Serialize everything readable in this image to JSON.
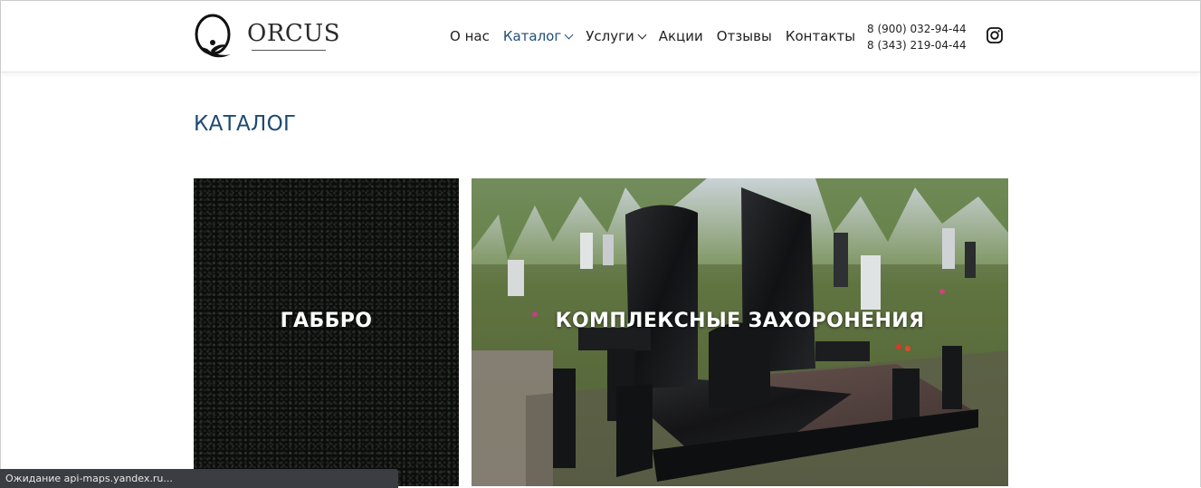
{
  "brand": {
    "name": "ORCUS"
  },
  "nav": {
    "items": [
      {
        "label": "О нас"
      },
      {
        "label": "Каталог"
      },
      {
        "label": "Услуги"
      },
      {
        "label": "Акции"
      },
      {
        "label": "Отзывы"
      },
      {
        "label": "Контакты"
      }
    ]
  },
  "contacts": {
    "phone1": "8 (900) 032-94-44",
    "phone2": "8 (343) 219-04-44"
  },
  "page": {
    "title": "КАТАЛОГ"
  },
  "catalog": {
    "cards": [
      {
        "label": "ГАББРО"
      },
      {
        "label": "КОМПЛЕКСНЫЕ ЗАХОРОНЕНИЯ"
      }
    ]
  },
  "statusbar": {
    "text": "Ожидание api-maps.yandex.ru..."
  },
  "colors": {
    "accent": "#1d4a72",
    "nav_active": "#1f4e79",
    "status_bg": "#3a3d42"
  },
  "icons": {
    "social": "instagram-icon",
    "dropdown": "chevron-down-icon"
  }
}
